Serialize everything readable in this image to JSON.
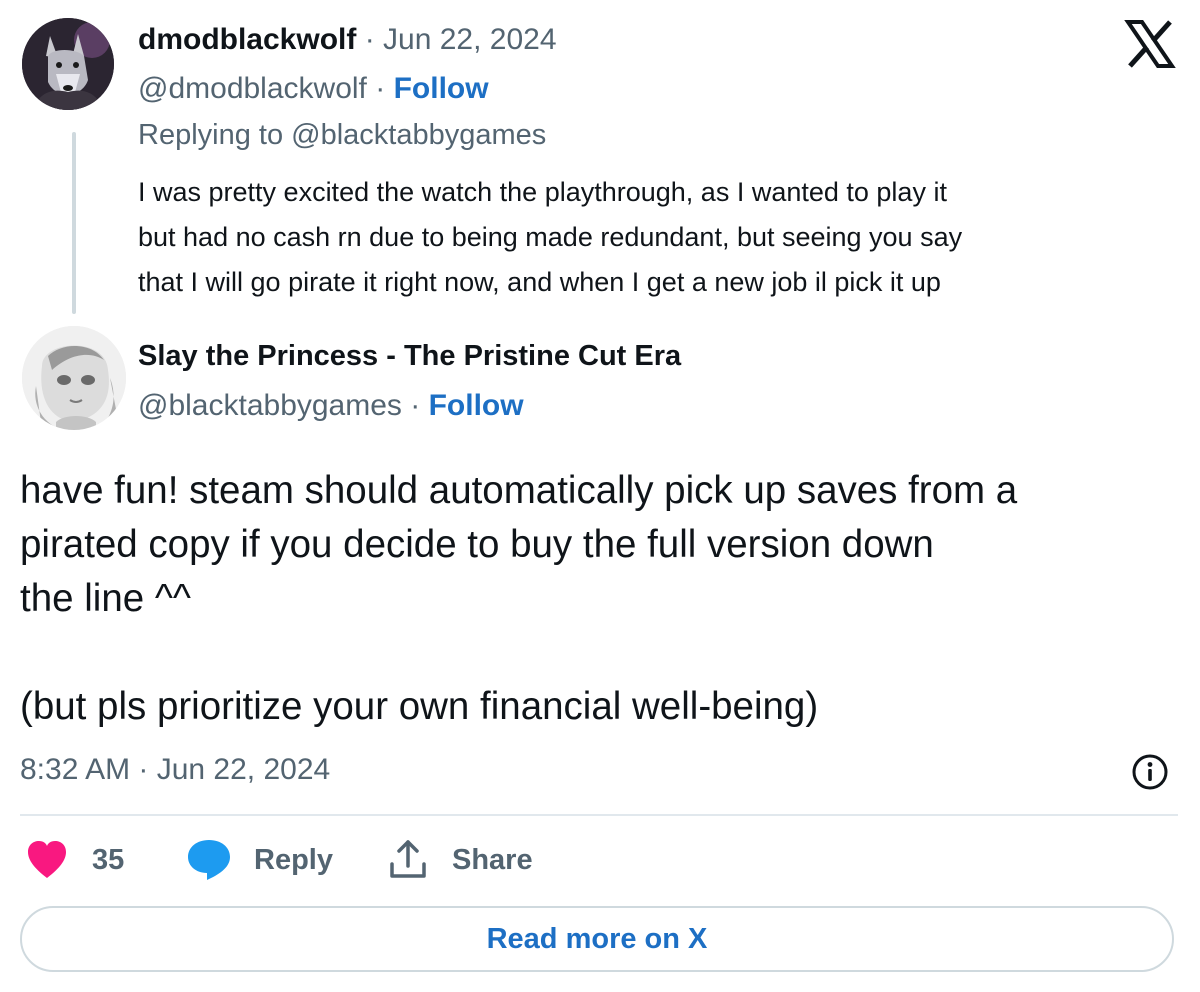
{
  "parent_tweet": {
    "display_name": "dmodblackwolf",
    "separator": "·",
    "date": "Jun 22, 2024",
    "handle": "@dmodblackwolf",
    "follow_label": "Follow",
    "replying_to": "Replying to @blacktabbygames",
    "text_lines": [
      "I was pretty excited the watch the playthrough, as I wanted to play it",
      "but had no cash rn due to being made redundant, but seeing you say",
      "that I will go pirate it right now, and when I get a new job il pick it up"
    ]
  },
  "main_tweet": {
    "display_name": "Slay the Princess - The Pristine Cut Era",
    "handle": "@blacktabbygames",
    "separator": "·",
    "follow_label": "Follow",
    "text_lines": [
      "have fun! steam should automatically pick up saves from a",
      "pirated copy if you decide to buy the full version down",
      "the line ^^",
      "",
      "(but pls prioritize your own financial well-being)"
    ],
    "timestamp": "8:32 AM · Jun 22, 2024"
  },
  "actions": {
    "like_count": "35",
    "reply_label": "Reply",
    "share_label": "Share"
  },
  "read_more_label": "Read more on X",
  "icons": {
    "logo": "x-logo-icon",
    "info": "info-icon",
    "like": "heart-icon",
    "reply": "speech-bubble-icon",
    "share": "share-icon"
  },
  "colors": {
    "heart": "#f91880",
    "reply_bubble": "#1d9bf0",
    "link": "#1d6fc4",
    "muted_text": "#536471"
  }
}
